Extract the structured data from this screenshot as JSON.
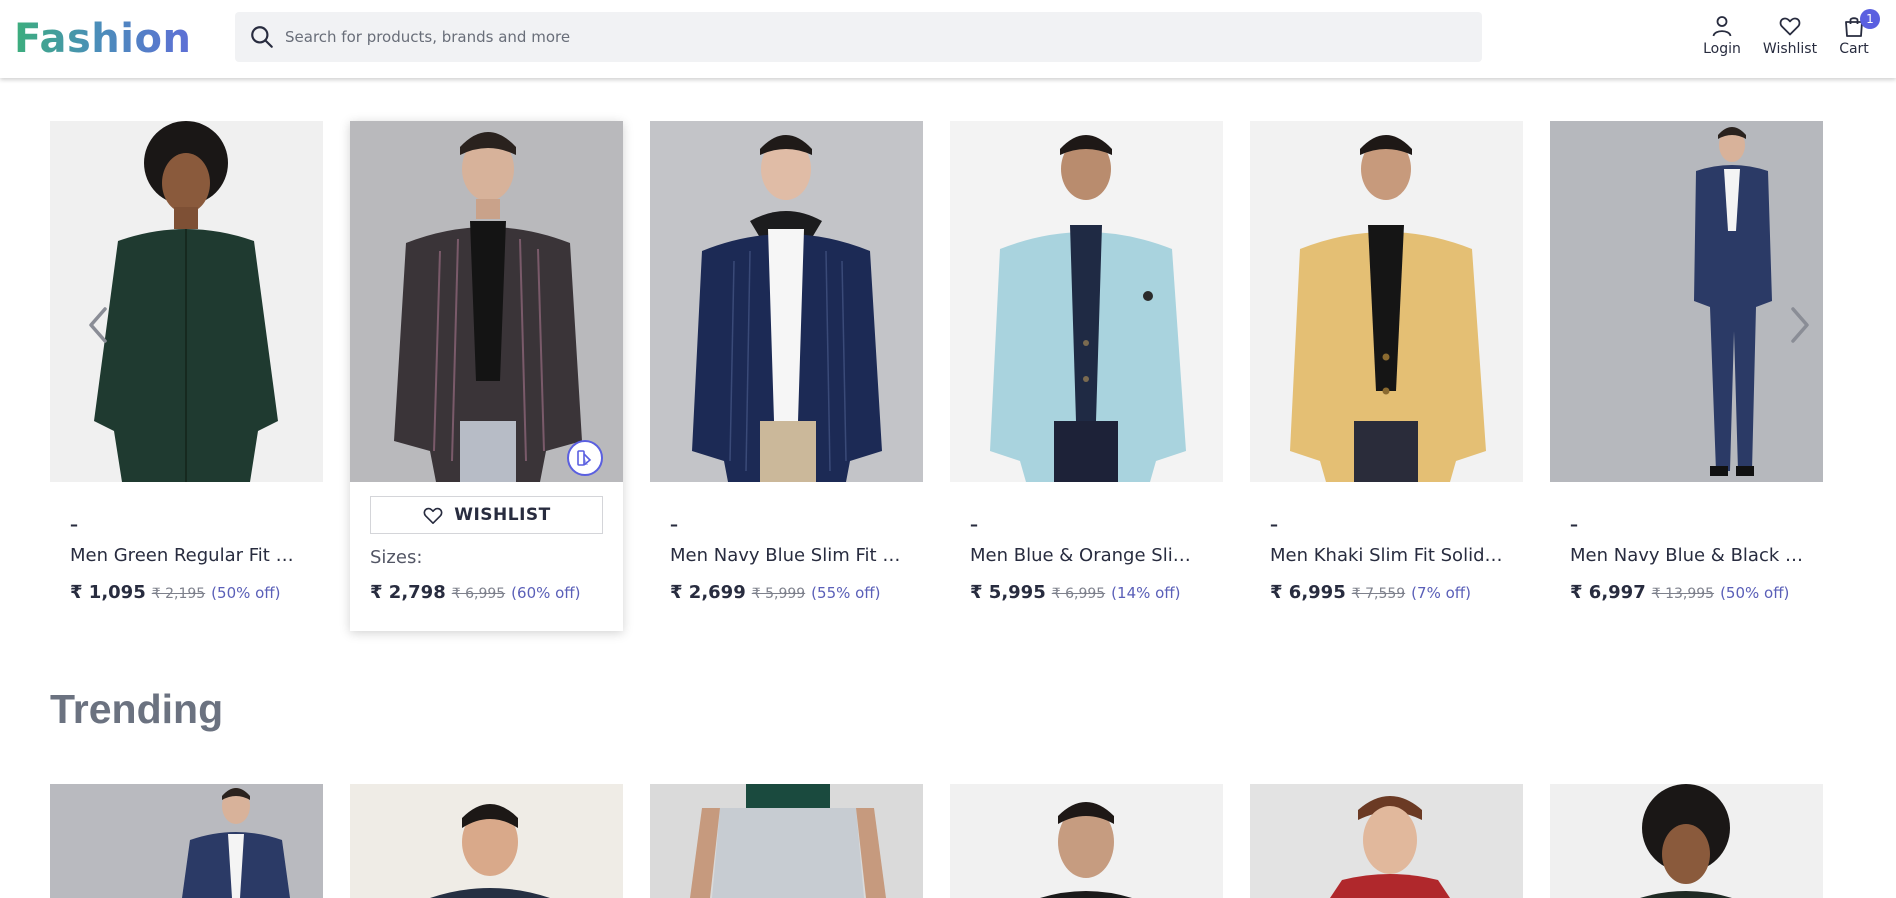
{
  "header": {
    "logo": "Fashion",
    "search_placeholder": "Search for products, brands and more",
    "login_label": "Login",
    "wishlist_label": "Wishlist",
    "cart_label": "Cart",
    "cart_count": "1"
  },
  "products": [
    {
      "dash": "–",
      "name": "Men Green Regular Fit Sol...",
      "price": "₹ 1,095",
      "mrp": "₹ 2,195",
      "off": "(50% off)"
    },
    {
      "name": "",
      "wishlist_label": "WISHLIST",
      "sizes_label": "Sizes:",
      "price": "₹ 2,798",
      "mrp": "₹ 6,995",
      "off": "(60% off)"
    },
    {
      "dash": "–",
      "name": "Men Navy Blue Slim Fit St...",
      "price": "₹ 2,699",
      "mrp": "₹ 5,999",
      "off": "(55% off)"
    },
    {
      "dash": "–",
      "name": "Men Blue & Orange Slim F...",
      "price": "₹ 5,995",
      "mrp": "₹ 6,995",
      "off": "(14% off)"
    },
    {
      "dash": "–",
      "name": "Men Khaki Slim Fit Solid S...",
      "price": "₹ 6,995",
      "mrp": "₹ 7,559",
      "off": "(7% off)"
    },
    {
      "dash": "–",
      "name": "Men Navy Blue & Black Sli...",
      "price": "₹ 6,997",
      "mrp": "₹ 13,995",
      "off": "(50% off)"
    }
  ],
  "trending": {
    "title": "Trending"
  },
  "colors": {
    "accent": "#5a5fe0",
    "offer_text": "#5a5fb8",
    "search_bg": "#f1f2f4"
  }
}
